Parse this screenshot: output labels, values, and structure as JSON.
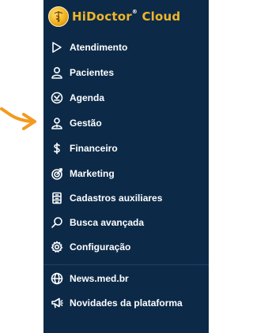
{
  "app": {
    "brand": "HiDoctor",
    "brand_mark": "®",
    "brand_suffix": "Cloud"
  },
  "menu": [
    {
      "icon": "play-outline-icon",
      "label": "Atendimento"
    },
    {
      "icon": "user-icon",
      "label": "Pacientes"
    },
    {
      "icon": "agenda-icon",
      "label": "Agenda"
    },
    {
      "icon": "manager-icon",
      "label": "Gestão"
    },
    {
      "icon": "dollar-icon",
      "label": "Financeiro"
    },
    {
      "icon": "target-icon",
      "label": "Marketing"
    },
    {
      "icon": "cabinet-icon",
      "label": "Cadastros auxiliares"
    },
    {
      "icon": "search-icon",
      "label": "Busca avançada"
    },
    {
      "icon": "gear-icon",
      "label": "Configuração"
    }
  ],
  "links": [
    {
      "icon": "globe-icon",
      "label": "News.med.br"
    },
    {
      "icon": "megaphone-icon",
      "label": "Novidades da plataforma"
    }
  ],
  "colors": {
    "sidebar_bg": "#0c2a48",
    "brand_gold": "#f0b52a",
    "pointer_orange": "#f39a1f"
  }
}
